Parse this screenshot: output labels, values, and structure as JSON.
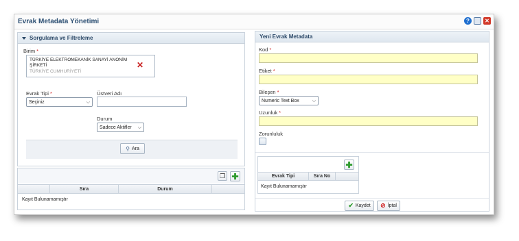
{
  "window": {
    "title": "Evrak Metadata Yönetimi"
  },
  "icons": {
    "help": "help-icon",
    "maximize": "window-icon",
    "close": "close-icon"
  },
  "filter_panel": {
    "title": "Sorgulama ve Filtreleme",
    "birim_label": "Birim",
    "birim_value_line1": "TÜRKİYE ELEKTROMEKANİK SANAYİ ANONİM",
    "birim_value_line2": "ŞİRKETİ",
    "birim_parent": "TÜRKİYE CUMHURİYETİ",
    "evrak_tipi_label": "Evrak Tipi",
    "evrak_tipi_value": "Seçiniz",
    "ustveri_label": "Üstveri Adı",
    "ustveri_value": "",
    "durum_label": "Durum",
    "durum_value": "Sadece Aktifler",
    "search_button": "Ara"
  },
  "results_table": {
    "columns": [
      "Sıra",
      "Durum"
    ],
    "empty_text": "Kayıt Bulunamamıştır"
  },
  "new_panel": {
    "title": "Yeni Evrak Metadata",
    "kod_label": "Kod",
    "etiket_label": "Etiket",
    "bilesen_label": "Bileşen",
    "bilesen_value": "Numeric Text Box",
    "uzunluk_label": "Uzunluk",
    "zorunluluk_label": "Zorunluluk",
    "sub_table": {
      "columns": [
        "Evrak Tipi",
        "Sıra No"
      ],
      "empty_text": "Kayıt Bulunamamıştır"
    },
    "save_button": "Kaydet",
    "cancel_button": "İptal"
  },
  "required_mark": "*",
  "colors": {
    "accent": "#2b4e72",
    "required": "#d02020",
    "field_highlight": "#ffffc6",
    "add_green": "#2e9b2e"
  }
}
